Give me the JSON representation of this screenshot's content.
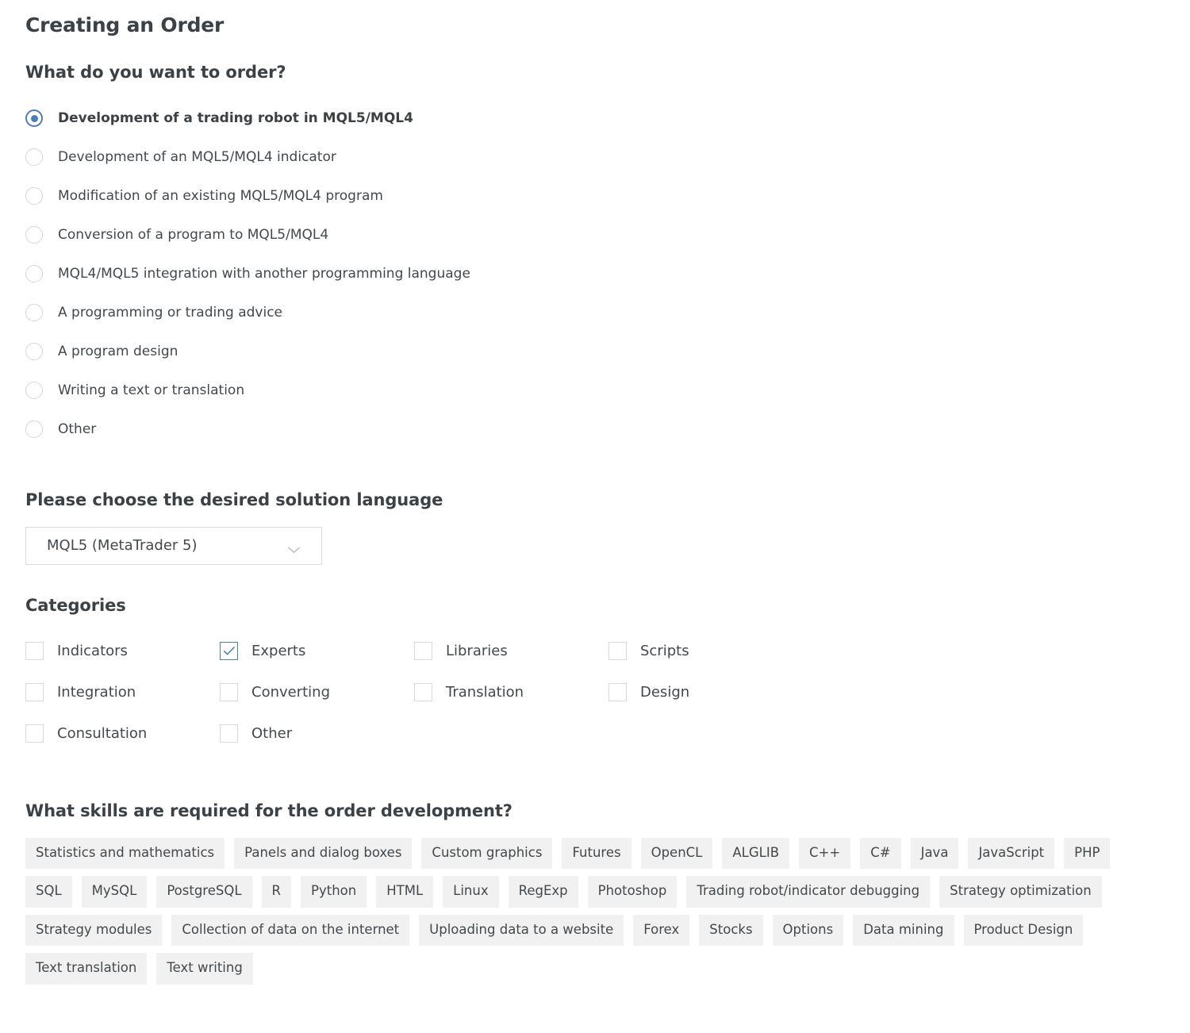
{
  "page": {
    "title": "Creating an Order"
  },
  "order_type": {
    "question": "What do you want to order?",
    "options": [
      {
        "label": "Development of a trading robot in MQL5/MQL4",
        "selected": true
      },
      {
        "label": "Development of an MQL5/MQL4 indicator",
        "selected": false
      },
      {
        "label": "Modification of an existing MQL5/MQL4 program",
        "selected": false
      },
      {
        "label": "Conversion of a program to MQL5/MQL4",
        "selected": false
      },
      {
        "label": "MQL4/MQL5 integration with another programming language",
        "selected": false
      },
      {
        "label": "A programming or trading advice",
        "selected": false
      },
      {
        "label": "A program design",
        "selected": false
      },
      {
        "label": "Writing a text or translation",
        "selected": false
      },
      {
        "label": "Other",
        "selected": false
      }
    ]
  },
  "language": {
    "question": "Please choose the desired solution language",
    "selected": "MQL5 (MetaTrader 5)",
    "chevron_icon": "chevron-down-icon"
  },
  "categories": {
    "title": "Categories",
    "items": [
      {
        "label": "Indicators",
        "checked": false
      },
      {
        "label": "Experts",
        "checked": true
      },
      {
        "label": "Libraries",
        "checked": false
      },
      {
        "label": "Scripts",
        "checked": false
      },
      {
        "label": "Integration",
        "checked": false
      },
      {
        "label": "Converting",
        "checked": false
      },
      {
        "label": "Translation",
        "checked": false
      },
      {
        "label": "Design",
        "checked": false
      },
      {
        "label": "Consultation",
        "checked": false
      },
      {
        "label": "Other",
        "checked": false
      }
    ]
  },
  "skills": {
    "question": "What skills are required for the order development?",
    "tags": [
      "Statistics and mathematics",
      "Panels and dialog boxes",
      "Custom graphics",
      "Futures",
      "OpenCL",
      "ALGLIB",
      "C++",
      "C#",
      "Java",
      "JavaScript",
      "PHP",
      "SQL",
      "MySQL",
      "PostgreSQL",
      "R",
      "Python",
      "HTML",
      "Linux",
      "RegExp",
      "Photoshop",
      "Trading robot/indicator debugging",
      "Strategy optimization",
      "Strategy modules",
      "Collection of data on the internet",
      "Uploading data to a website",
      "Forex",
      "Stocks",
      "Options",
      "Data mining",
      "Product Design",
      "Text translation",
      "Text writing"
    ]
  },
  "colors": {
    "accent": "#4a7ebb",
    "text": "#43484c",
    "heading": "#3c4145",
    "tag_bg": "#f1f1f1",
    "border": "#d9dcde"
  }
}
